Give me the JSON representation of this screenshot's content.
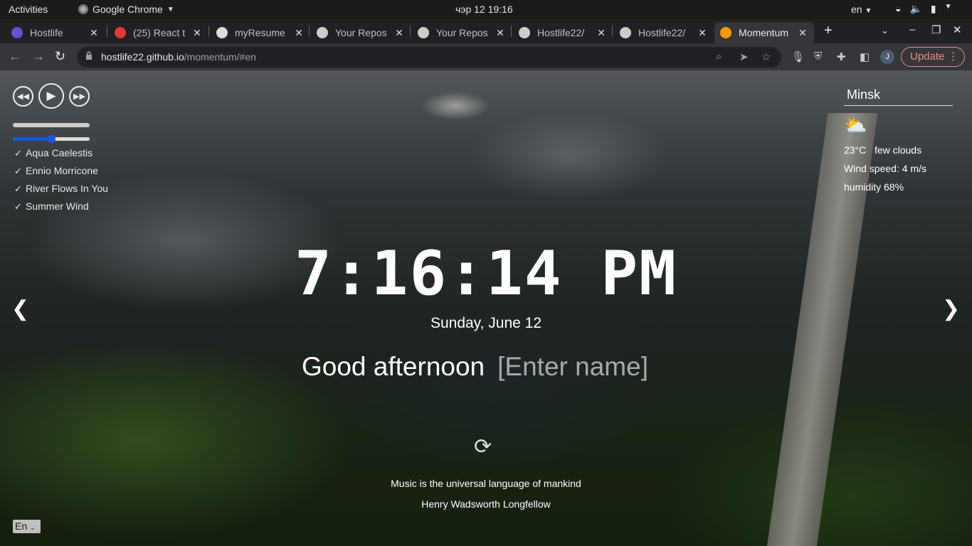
{
  "os": {
    "activities": "Activities",
    "app": "Google Chrome",
    "clock": "чэр 12  19:16",
    "lang": "en"
  },
  "tabs": [
    {
      "title": "Hostlife",
      "icon": "momentum-icon",
      "color": "#6b4fd0"
    },
    {
      "title": "(25) React t",
      "icon": "youtube-icon",
      "color": "#e53935"
    },
    {
      "title": "myResume",
      "icon": "globe-icon",
      "color": "#dddddd"
    },
    {
      "title": "Your Repos",
      "icon": "github-icon",
      "color": "#cccccc"
    },
    {
      "title": "Your Repos",
      "icon": "github-icon",
      "color": "#cccccc"
    },
    {
      "title": "Hostlife22/",
      "icon": "github-icon",
      "color": "#cccccc"
    },
    {
      "title": "Hostlife22/",
      "icon": "github-icon",
      "color": "#cccccc"
    },
    {
      "title": "Momentum",
      "icon": "momentum-icon",
      "color": "#f29900"
    }
  ],
  "toolbar": {
    "url_host": "hostlife22.github.io",
    "url_path": "/momentum/#en",
    "update": "Update",
    "avatar": "J"
  },
  "weather": {
    "city": "Minsk",
    "temp": "23°C",
    "desc": "few clouds",
    "wind": "Wind speed: 4 m/s",
    "humidity": "humidity 68%"
  },
  "playlist": [
    "Aqua Caelestis",
    "Ennio Morricone",
    "River Flows In You",
    "Summer Wind"
  ],
  "player": {
    "progress": 0,
    "volume": 0.5
  },
  "clock": {
    "time": "7:16:14 PM",
    "date": "Sunday, June 12"
  },
  "greeting": {
    "text": "Good afternoon",
    "placeholder": "[Enter name]"
  },
  "quote": {
    "text": "Music is the universal language of mankind",
    "author": "Henry Wadsworth Longfellow"
  },
  "language": "En"
}
